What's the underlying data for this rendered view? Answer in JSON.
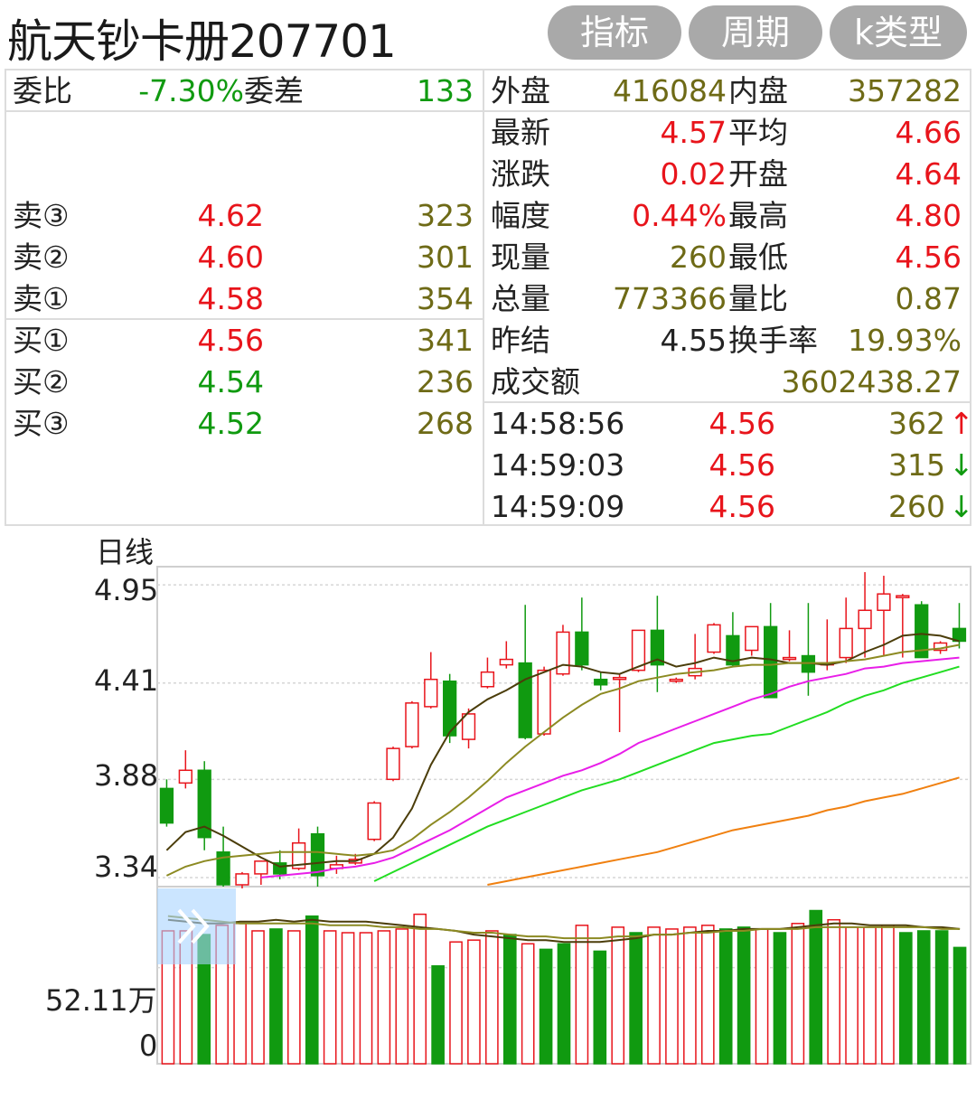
{
  "header": {
    "title": "航天钞卡册207701",
    "buttons": [
      "指标",
      "周期",
      "k类型"
    ]
  },
  "order_summary": {
    "weibi_label": "委比",
    "weibi_value": "-7.30%",
    "weicha_label": "委差",
    "weicha_value": "133"
  },
  "order_book": {
    "asks": [
      {
        "label": "卖③",
        "price": "4.62",
        "volume": "323"
      },
      {
        "label": "卖②",
        "price": "4.60",
        "volume": "301"
      },
      {
        "label": "卖①",
        "price": "4.58",
        "volume": "354"
      }
    ],
    "bids": [
      {
        "label": "买①",
        "price": "4.56",
        "volume": "341"
      },
      {
        "label": "买②",
        "price": "4.54",
        "volume": "236"
      },
      {
        "label": "买③",
        "price": "4.52",
        "volume": "268"
      }
    ]
  },
  "quote": {
    "waipan_label": "外盘",
    "waipan_value": "416084",
    "neipan_label": "内盘",
    "neipan_value": "357282",
    "rows": [
      {
        "l1": "最新",
        "v1": "4.57",
        "l2": "平均",
        "v2": "4.66"
      },
      {
        "l1": "涨跌",
        "v1": "0.02",
        "l2": "开盘",
        "v2": "4.64"
      },
      {
        "l1": "幅度",
        "v1": "0.44%",
        "l2": "最高",
        "v2": "4.80"
      },
      {
        "l1": "现量",
        "v1": "260",
        "l2": "最低",
        "v2": "4.56"
      },
      {
        "l1": "总量",
        "v1": "773366",
        "l2": "量比",
        "v2": "0.87"
      },
      {
        "l1": "昨结",
        "v1": "4.55",
        "l2": "换手率",
        "v2": "19.93%"
      }
    ],
    "turnover_label": "成交额",
    "turnover_value": "3602438.27"
  },
  "ticks": [
    {
      "time": "14:58:56",
      "price": "4.56",
      "volume": "362",
      "dir": "↑"
    },
    {
      "time": "14:59:03",
      "price": "4.56",
      "volume": "315",
      "dir": "↓"
    },
    {
      "time": "14:59:09",
      "price": "4.56",
      "volume": "260",
      "dir": "↓"
    }
  ],
  "chart_labels": {
    "period": "日线",
    "price_ticks": [
      "4.95",
      "4.41",
      "3.88",
      "3.34"
    ],
    "volume_ticks": [
      "52.11万",
      "0"
    ]
  },
  "colors": {
    "up": "#e8141b",
    "down": "#109a10",
    "olive": "#6e6a16",
    "ma_dark": "#4b3d0a",
    "ma_olive": "#8c8a22",
    "ma_magenta": "#e81ee8",
    "ma_green": "#22dd22",
    "ma_orange": "#f08010",
    "overlay": "#a8d4ff"
  },
  "chart_data": [
    {
      "type": "candlestick",
      "ylim": [
        3.29,
        5.05
      ],
      "price_ticks": [
        4.95,
        4.41,
        3.88,
        3.34
      ],
      "candles": [
        {
          "o": 3.83,
          "h": 3.88,
          "l": 3.62,
          "c": 3.64
        },
        {
          "o": 3.86,
          "h": 4.04,
          "l": 3.83,
          "c": 3.93
        },
        {
          "o": 3.93,
          "h": 3.98,
          "l": 3.49,
          "c": 3.56
        },
        {
          "o": 3.48,
          "h": 3.62,
          "l": 3.29,
          "c": 3.3
        },
        {
          "o": 3.3,
          "h": 3.37,
          "l": 3.28,
          "c": 3.36
        },
        {
          "o": 3.36,
          "h": 3.41,
          "l": 3.3,
          "c": 3.43
        },
        {
          "o": 3.42,
          "h": 3.49,
          "l": 3.33,
          "c": 3.36
        },
        {
          "o": 3.39,
          "h": 3.61,
          "l": 3.38,
          "c": 3.53
        },
        {
          "o": 3.58,
          "h": 3.62,
          "l": 3.29,
          "c": 3.35
        },
        {
          "o": 3.39,
          "h": 3.46,
          "l": 3.36,
          "c": 3.41
        },
        {
          "o": 3.42,
          "h": 3.47,
          "l": 3.41,
          "c": 3.44
        },
        {
          "o": 3.55,
          "h": 3.76,
          "l": 3.54,
          "c": 3.75
        },
        {
          "o": 3.88,
          "h": 4.06,
          "l": 3.87,
          "c": 4.05
        },
        {
          "o": 4.06,
          "h": 4.31,
          "l": 4.05,
          "c": 4.3
        },
        {
          "o": 4.28,
          "h": 4.58,
          "l": 4.27,
          "c": 4.43
        },
        {
          "o": 4.42,
          "h": 4.46,
          "l": 4.08,
          "c": 4.12
        },
        {
          "o": 4.1,
          "h": 4.27,
          "l": 4.05,
          "c": 4.24
        },
        {
          "o": 4.39,
          "h": 4.55,
          "l": 4.38,
          "c": 4.47
        },
        {
          "o": 4.51,
          "h": 4.64,
          "l": 4.49,
          "c": 4.54
        },
        {
          "o": 4.52,
          "h": 4.84,
          "l": 4.1,
          "c": 4.11
        },
        {
          "o": 4.13,
          "h": 4.5,
          "l": 4.12,
          "c": 4.48
        },
        {
          "o": 4.46,
          "h": 4.73,
          "l": 4.45,
          "c": 4.69
        },
        {
          "o": 4.69,
          "h": 4.88,
          "l": 4.48,
          "c": 4.51
        },
        {
          "o": 4.43,
          "h": 4.47,
          "l": 4.37,
          "c": 4.4
        },
        {
          "o": 4.43,
          "h": 4.46,
          "l": 4.14,
          "c": 4.44
        },
        {
          "o": 4.48,
          "h": 4.7,
          "l": 4.47,
          "c": 4.7
        },
        {
          "o": 4.7,
          "h": 4.89,
          "l": 4.36,
          "c": 4.51
        },
        {
          "o": 4.42,
          "h": 4.44,
          "l": 4.41,
          "c": 4.43
        },
        {
          "o": 4.45,
          "h": 4.68,
          "l": 4.43,
          "c": 4.49
        },
        {
          "o": 4.58,
          "h": 4.74,
          "l": 4.57,
          "c": 4.73
        },
        {
          "o": 4.67,
          "h": 4.8,
          "l": 4.5,
          "c": 4.51
        },
        {
          "o": 4.59,
          "h": 4.72,
          "l": 4.56,
          "c": 4.72
        },
        {
          "o": 4.72,
          "h": 4.85,
          "l": 4.33,
          "c": 4.33
        },
        {
          "o": 4.54,
          "h": 4.7,
          "l": 4.53,
          "c": 4.55
        },
        {
          "o": 4.56,
          "h": 4.85,
          "l": 4.34,
          "c": 4.47
        },
        {
          "o": 4.51,
          "h": 4.76,
          "l": 4.48,
          "c": 4.52
        },
        {
          "o": 4.55,
          "h": 4.88,
          "l": 4.52,
          "c": 4.71
        },
        {
          "o": 4.71,
          "h": 5.02,
          "l": 4.55,
          "c": 4.81
        },
        {
          "o": 4.81,
          "h": 5.0,
          "l": 4.56,
          "c": 4.9
        },
        {
          "o": 4.88,
          "h": 4.9,
          "l": 4.55,
          "c": 4.89
        },
        {
          "o": 4.84,
          "h": 4.86,
          "l": 4.55,
          "c": 4.55
        },
        {
          "o": 4.59,
          "h": 4.64,
          "l": 4.57,
          "c": 4.63
        },
        {
          "o": 4.71,
          "h": 4.85,
          "l": 4.6,
          "c": 4.64
        }
      ],
      "ma_lines": [
        {
          "color_key": "ma_dark",
          "values": [
            3.49,
            3.59,
            3.62,
            3.57,
            3.51,
            3.45,
            3.4,
            3.41,
            3.42,
            3.43,
            3.43,
            3.47,
            3.56,
            3.72,
            3.96,
            4.14,
            4.25,
            4.32,
            4.37,
            4.43,
            4.47,
            4.51,
            4.5,
            4.47,
            4.46,
            4.5,
            4.54,
            4.5,
            4.52,
            4.55,
            4.53,
            4.55,
            4.54,
            4.52,
            4.52,
            4.51,
            4.53,
            4.58,
            4.62,
            4.67,
            4.68,
            4.67,
            4.64
          ]
        },
        {
          "color_key": "ma_olive",
          "values": [
            3.35,
            3.4,
            3.43,
            3.45,
            3.46,
            3.47,
            3.48,
            3.48,
            3.48,
            3.47,
            3.46,
            3.47,
            3.49,
            3.55,
            3.63,
            3.7,
            3.78,
            3.87,
            3.97,
            4.06,
            4.14,
            4.22,
            4.29,
            4.35,
            4.38,
            4.42,
            4.44,
            4.46,
            4.47,
            4.48,
            4.5,
            4.51,
            4.51,
            4.52,
            4.52,
            4.52,
            4.53,
            4.54,
            4.56,
            4.58,
            4.59,
            4.6,
            4.62
          ]
        },
        {
          "color_key": "ma_magenta",
          "values": [
            null,
            null,
            null,
            null,
            null,
            3.34,
            3.35,
            3.36,
            3.37,
            3.39,
            3.4,
            3.42,
            3.45,
            3.5,
            3.55,
            3.6,
            3.66,
            3.72,
            3.78,
            3.82,
            3.86,
            3.9,
            3.93,
            3.97,
            4.02,
            4.08,
            4.12,
            4.16,
            4.2,
            4.24,
            4.28,
            4.32,
            4.35,
            4.39,
            4.42,
            4.44,
            4.46,
            4.49,
            4.5,
            4.52,
            4.53,
            4.54,
            4.55
          ]
        },
        {
          "color_key": "ma_green",
          "values": [
            null,
            null,
            null,
            null,
            null,
            null,
            null,
            null,
            null,
            null,
            null,
            3.32,
            3.37,
            3.42,
            3.47,
            3.52,
            3.57,
            3.62,
            3.66,
            3.7,
            3.74,
            3.78,
            3.82,
            3.85,
            3.88,
            3.92,
            3.96,
            4.0,
            4.04,
            4.08,
            4.1,
            4.12,
            4.13,
            4.17,
            4.21,
            4.25,
            4.3,
            4.34,
            4.37,
            4.41,
            4.44,
            4.47,
            4.5
          ]
        },
        {
          "color_key": "ma_orange",
          "values": [
            null,
            null,
            null,
            null,
            null,
            null,
            null,
            null,
            null,
            null,
            null,
            null,
            null,
            null,
            null,
            null,
            null,
            3.3,
            3.32,
            3.34,
            3.36,
            3.38,
            3.4,
            3.42,
            3.44,
            3.46,
            3.48,
            3.51,
            3.54,
            3.57,
            3.6,
            3.62,
            3.64,
            3.66,
            3.68,
            3.71,
            3.73,
            3.76,
            3.78,
            3.8,
            3.83,
            3.86,
            3.89
          ]
        }
      ]
    },
    {
      "type": "bar",
      "ylim": [
        0,
        95
      ],
      "unit": "万",
      "ticks": [
        52.11,
        0
      ],
      "values": [
        72,
        72,
        70,
        75,
        76,
        72,
        73,
        72,
        80,
        72,
        71,
        71,
        72,
        73,
        81,
        53,
        66,
        67,
        72,
        70,
        65,
        62,
        65,
        75,
        61,
        74,
        71,
        74,
        73,
        74,
        75,
        73,
        74,
        73,
        71,
        76,
        83,
        78,
        74,
        74,
        75,
        71,
        72,
        72,
        63
      ],
      "ma_lines": [
        {
          "color_key": "ma_dark",
          "values": [
            78,
            77,
            76,
            76,
            77,
            77,
            78,
            77,
            78,
            77,
            77,
            77,
            76,
            75,
            74,
            73,
            72,
            70,
            69,
            68,
            67,
            67,
            66,
            66,
            66,
            67,
            68,
            70,
            70,
            71,
            72,
            72,
            73,
            73,
            73,
            74,
            75,
            76,
            76,
            75,
            75,
            75,
            74,
            74,
            73
          ]
        },
        {
          "color_key": "ma_olive",
          "values": [
            80,
            79,
            78,
            77,
            76,
            76,
            76,
            76,
            76,
            75,
            75,
            75,
            74,
            74,
            73,
            73,
            72,
            71,
            71,
            70,
            69,
            69,
            68,
            68,
            68,
            69,
            69,
            70,
            70,
            71,
            71,
            72,
            72,
            73,
            73,
            73,
            74,
            74,
            74,
            74,
            74,
            74,
            74,
            73,
            73
          ]
        }
      ]
    }
  ]
}
